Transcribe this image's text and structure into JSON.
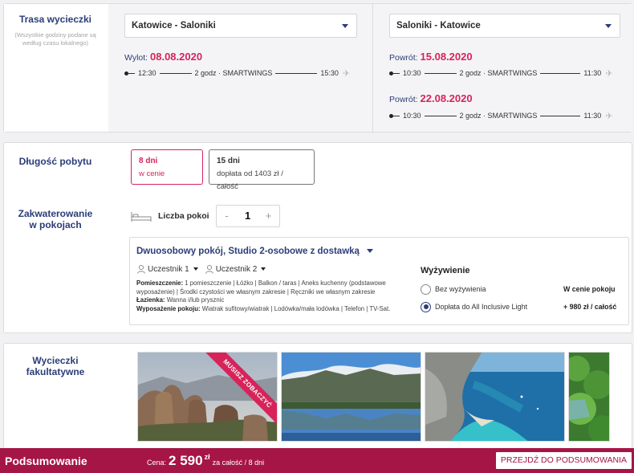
{
  "route": {
    "label": "Trasa wycieczki",
    "note": "(Wszystkie godziny podane są według czasu lokalnego)",
    "outbound": {
      "select": "Katowice - Saloniki",
      "date_label": "Wylot:",
      "date": "08.08.2020",
      "flight": {
        "dep": "12:30",
        "info": "2 godz · SMARTWINGS",
        "arr": "15:30"
      }
    },
    "return": {
      "select": "Saloniki - Katowice",
      "options": [
        {
          "date_label": "Powrót:",
          "date": "15.08.2020",
          "flight": {
            "dep": "10:30",
            "info": "2 godz · SMARTWINGS",
            "arr": "11:30"
          }
        },
        {
          "date_label": "Powrót:",
          "date": "22.08.2020",
          "flight": {
            "dep": "10:30",
            "info": "2 godz · SMARTWINGS",
            "arr": "11:30"
          }
        }
      ]
    }
  },
  "stay": {
    "label": "Długość pobytu",
    "options": [
      {
        "title": "8 dni",
        "sub": "w cenie"
      },
      {
        "title": "15 dni",
        "sub": "dopłata od 1403 zł / całość"
      }
    ],
    "accommodation_label": "Zakwaterowanie w pokojach",
    "rooms_label": "Liczba pokoi",
    "rooms_minus": "-",
    "rooms_value": "1",
    "rooms_plus": "+",
    "room": {
      "title": "Dwuosobowy pokój, Studio 2-osobowe z dostawką",
      "participants": [
        "Uczestnik 1",
        "Uczestnik 2"
      ],
      "desc_room_label": "Pomieszczenie:",
      "desc_room": "1 pomieszczenie | Łóżko | Balkon / taras | Aneks kuchenny (podstawowe wyposażenie) | Środki czystości we własnym zakresie | Ręczniki we własnym zakresie",
      "desc_bath_label": "Łazienka:",
      "desc_bath": "Wanna i/lub prysznic",
      "desc_equip_label": "Wyposażenie pokoju:",
      "desc_equip": "Wiatrak sufitowy/wiatrak | Lodówka/mała lodówka | Telefon | TV-Sat."
    },
    "board": {
      "title": "Wyżywienie",
      "options": [
        {
          "label": "Bez wyżywienia",
          "price": "W cenie pokoju",
          "selected": false
        },
        {
          "label": "Dopłata do All Inclusive Light",
          "price": "+ 980 zł / całość",
          "selected": true
        }
      ]
    }
  },
  "excursions": {
    "label": "Wycieczki fakultatywne",
    "ribbon": "MUSISZ ZOBACZYĆ"
  },
  "summary": {
    "title": "Podsumowanie",
    "price_label": "Cena:",
    "price": "2 590",
    "currency": "zł",
    "price_suffix": "za całość / 8 dni",
    "cta": "PRZEJDŹ DO PODSUMOWANIA"
  },
  "colors": {
    "accent": "#d6245a",
    "navy": "#2c3d78",
    "bar": "#a51545"
  }
}
